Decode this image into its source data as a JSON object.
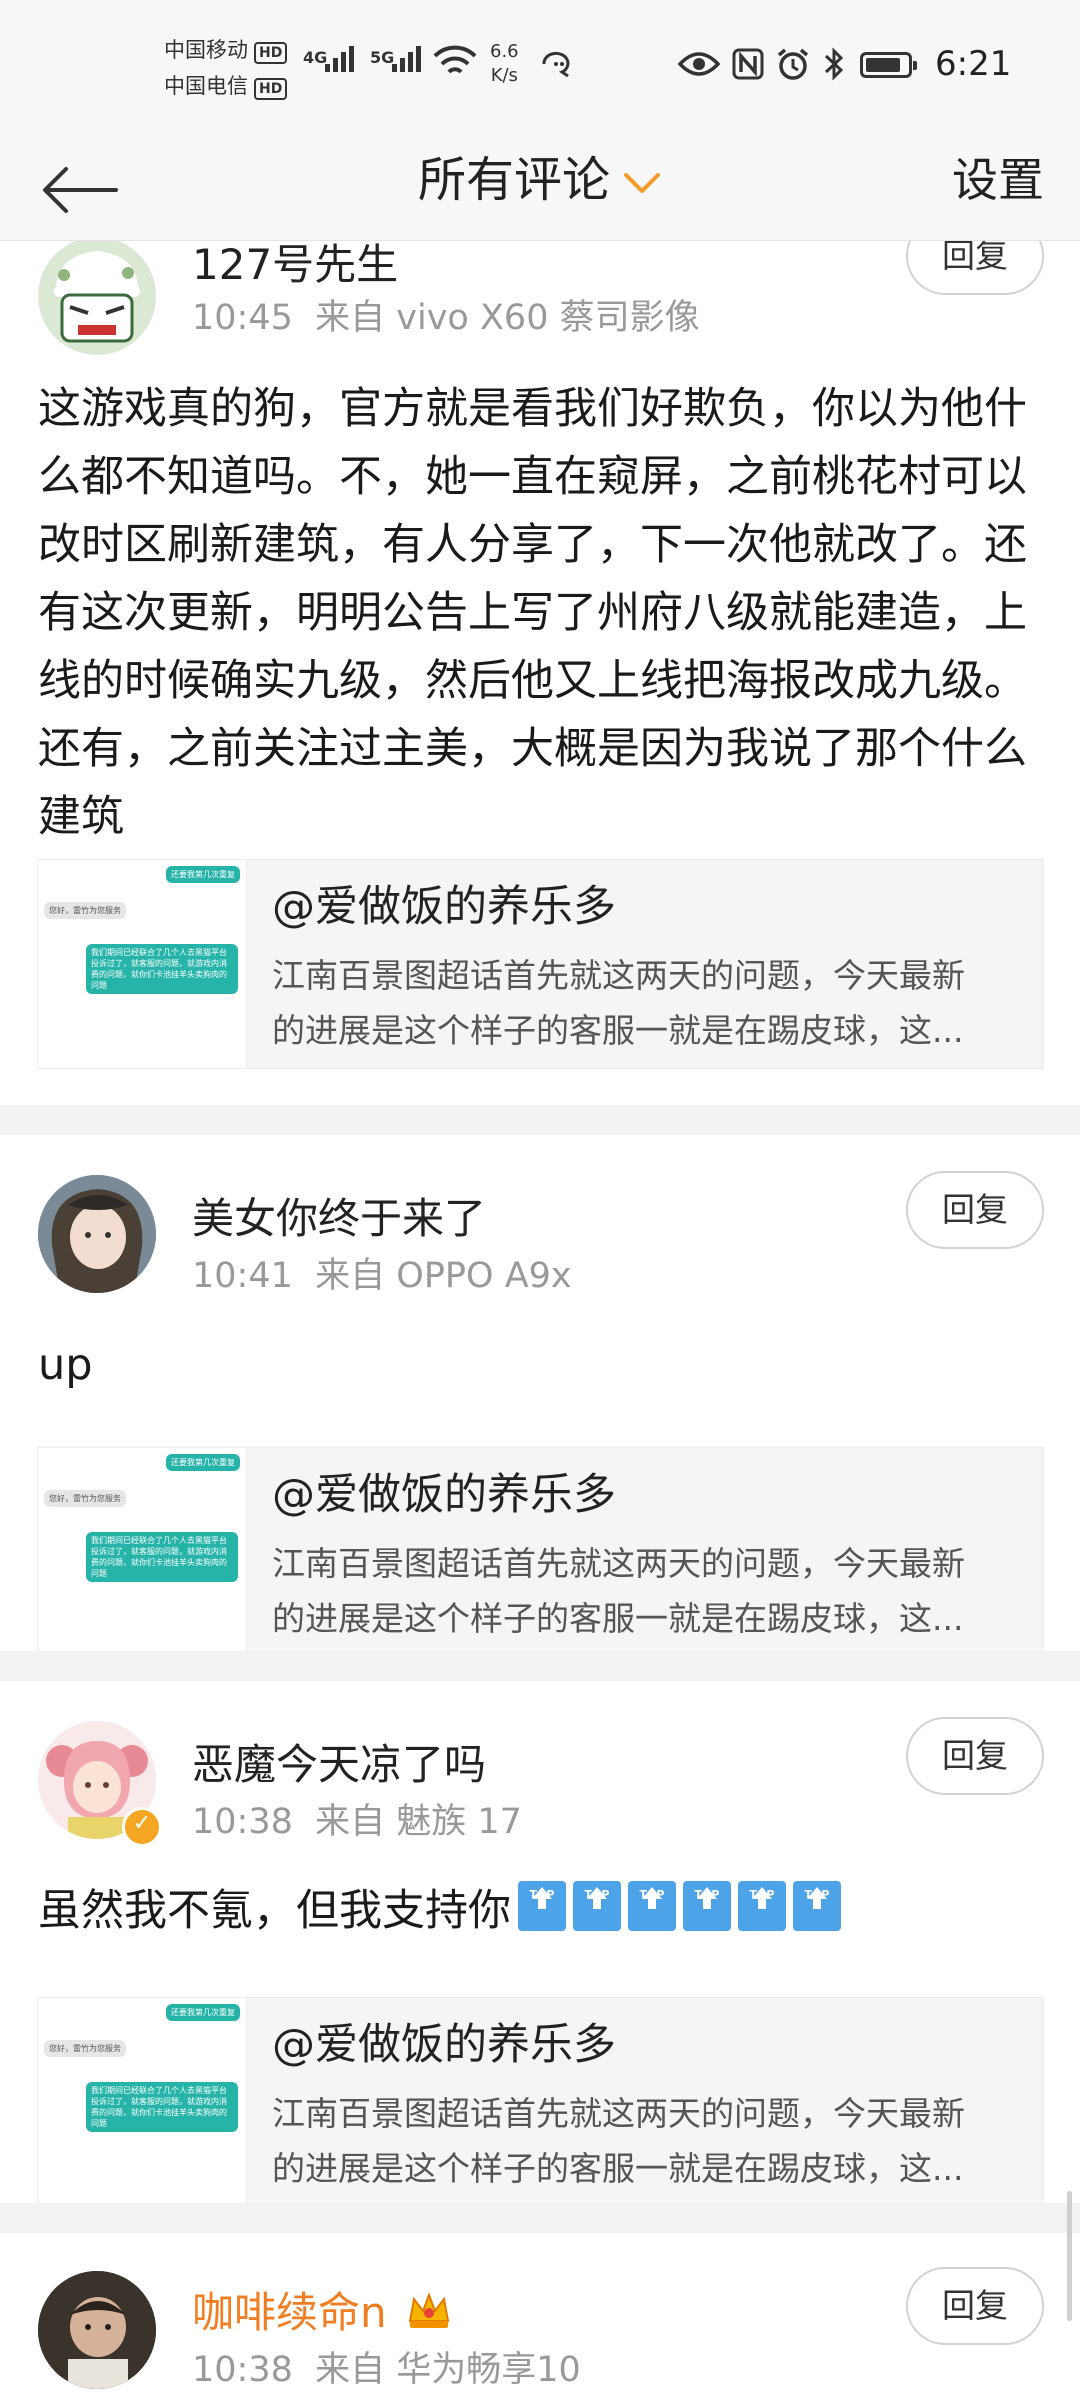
{
  "status_bar": {
    "carrier1": "中国移动",
    "carrier2": "中国电信",
    "hd": "HD",
    "net1": "4G",
    "net2": "5G",
    "speed_value": "6.6",
    "speed_unit": "K/s",
    "time": "6:21",
    "icons": [
      "signal-icon",
      "wifi-icon",
      "hotspot-icon",
      "eye-icon",
      "nfc-icon",
      "alarm-icon",
      "bluetooth-icon",
      "battery-icon"
    ]
  },
  "nav": {
    "title": "所有评论",
    "settings": "设置",
    "accent": "#f39b2c"
  },
  "shared_card": {
    "title": "@爱做饭的养乐多",
    "desc_line1": "江南百景图超话首先就这两天的问题，今天最新",
    "desc_line2": "的进展是这个样子的客服一就是在踢皮球，这...",
    "thumb": {
      "top_bubble": "还要我第几次重复",
      "gray_bubble": "您好，雷竹为您服务",
      "teal_bubble": "我们期间已经联合了几个人去黑猫平台投诉过了，就客服的问题，就游戏内消费的问题，就你们卡池挂羊头卖狗肉的问题"
    }
  },
  "comments": [
    {
      "username": "127号先生",
      "time": "10:45",
      "source": "来自 vivo X60 蔡司影像",
      "reply": "回复",
      "body": "这游戏真的狗，官方就是看我们好欺负，你以为他什么都不知道吗。不，她一直在窥屏，之前桃花村可以改时区刷新建筑，有人分享了，下一次他就改了。还有这次更新，明明公告上写了州府八级就能建造，上线的时候确实九级，然后他又上线把海报改成九级。还有，之前关注过主美，大概是因为我说了那个什么建筑"
    },
    {
      "username": "美女你终于来了",
      "time": "10:41",
      "source": "来自 OPPO A9x",
      "reply": "回复",
      "body": "up"
    },
    {
      "username": "恶魔今天凉了吗",
      "time": "10:38",
      "source": "来自 魅族 17",
      "reply": "回复",
      "body": "虽然我不氪，但我支持你",
      "badge_label": "TOP",
      "badge_count": 6
    },
    {
      "username": "咖啡续命n",
      "time": "10:38",
      "source": "来自 华为畅享10",
      "reply": "回复",
      "username_color": "#f07f24"
    }
  ]
}
